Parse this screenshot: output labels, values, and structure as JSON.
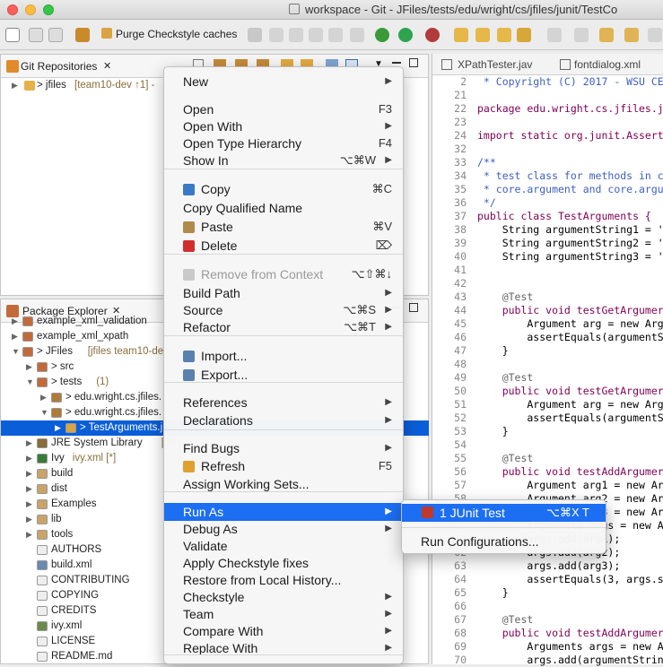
{
  "window": {
    "title": "workspace - Git - JFiles/tests/edu/wright/cs/jfiles/junit/TestCo"
  },
  "toolbar": {
    "purge_label": "Purge Checkstyle caches"
  },
  "git_view": {
    "tab_label": "Git Repositories",
    "tab_close": "✕",
    "repo_name": "> jfiles",
    "repo_meta": "[team10-dev ↑1] -"
  },
  "package_view": {
    "tab_label": "Package Explorer",
    "tab_close": "✕",
    "items": [
      {
        "label": "example_xml_validation",
        "meta": ""
      },
      {
        "label": "example_xml_xpath",
        "meta": ""
      },
      {
        "label": "> JFiles",
        "meta": "[jfiles team10-dev"
      },
      {
        "label": "> src",
        "meta": ""
      },
      {
        "label": "> tests",
        "meta": "(1)"
      },
      {
        "label": "> edu.wright.cs.jfiles.",
        "meta": ""
      },
      {
        "label": "> edu.wright.cs.jfiles.",
        "meta": ""
      },
      {
        "label": "> TestArguments.j",
        "meta": ""
      },
      {
        "label": "JRE System Library",
        "meta": "[Jav"
      },
      {
        "label": "Ivy",
        "meta": "ivy.xml [*]"
      },
      {
        "label": "build",
        "meta": ""
      },
      {
        "label": "dist",
        "meta": ""
      },
      {
        "label": "Examples",
        "meta": ""
      },
      {
        "label": "lib",
        "meta": ""
      },
      {
        "label": "tools",
        "meta": ""
      },
      {
        "label": "AUTHORS",
        "meta": ""
      },
      {
        "label": "build.xml",
        "meta": ""
      },
      {
        "label": "CONTRIBUTING",
        "meta": ""
      },
      {
        "label": "COPYING",
        "meta": ""
      },
      {
        "label": "CREDITS",
        "meta": ""
      },
      {
        "label": "ivy.xml",
        "meta": ""
      },
      {
        "label": "LICENSE",
        "meta": ""
      },
      {
        "label": "README.md",
        "meta": ""
      }
    ]
  },
  "editor": {
    "tabs": [
      "XPathTester.jav",
      "fontdialog.xml"
    ],
    "lines": [
      {
        "n": "2",
        "text": " * Copyright (C) 2017 - WSU CE"
      },
      {
        "n": "21",
        "text": ""
      },
      {
        "n": "22",
        "text": "package edu.wright.cs.jfiles.j"
      },
      {
        "n": "23",
        "text": ""
      },
      {
        "n": "24",
        "text": "import static org.junit.Assert"
      },
      {
        "n": "32",
        "text": ""
      },
      {
        "n": "33",
        "text": "/**"
      },
      {
        "n": "34",
        "text": " * test class for methods in c"
      },
      {
        "n": "35",
        "text": " * core.argument and core.argu"
      },
      {
        "n": "36",
        "text": " */"
      },
      {
        "n": "37",
        "text": "public class TestArguments {"
      },
      {
        "n": "38",
        "text": "    String argumentString1 = '"
      },
      {
        "n": "39",
        "text": "    String argumentString2 = '"
      },
      {
        "n": "40",
        "text": "    String argumentString3 = '"
      },
      {
        "n": "41",
        "text": ""
      },
      {
        "n": "42",
        "text": ""
      },
      {
        "n": "43",
        "text": "    @Test"
      },
      {
        "n": "44",
        "text": "    public void testGetArgumer"
      },
      {
        "n": "45",
        "text": "        Argument arg = new Arg"
      },
      {
        "n": "46",
        "text": "        assertEquals(argumentS"
      },
      {
        "n": "47",
        "text": "    }"
      },
      {
        "n": "48",
        "text": ""
      },
      {
        "n": "49",
        "text": "    @Test"
      },
      {
        "n": "50",
        "text": "    public void testGetArgumer"
      },
      {
        "n": "51",
        "text": "        Argument arg = new Arg"
      },
      {
        "n": "52",
        "text": "        assertEquals(argumentS"
      },
      {
        "n": "53",
        "text": "    }"
      },
      {
        "n": "54",
        "text": ""
      },
      {
        "n": "55",
        "text": "    @Test"
      },
      {
        "n": "56",
        "text": "    public void testAddArgumer"
      },
      {
        "n": "57",
        "text": "        Argument arg1 = new Ar"
      },
      {
        "n": "58",
        "text": "        Argument arg2 = new Ar"
      },
      {
        "n": "59",
        "text": "        Argument arg3 = new Ar"
      },
      {
        "n": "60",
        "text": "        Arguments args = new A"
      },
      {
        "n": "61",
        "text": "        args.add(arg1);"
      },
      {
        "n": "62",
        "text": "        args.add(arg2);"
      },
      {
        "n": "63",
        "text": "        args.add(arg3);"
      },
      {
        "n": "64",
        "text": "        assertEquals(3, args.s"
      },
      {
        "n": "65",
        "text": "    }"
      },
      {
        "n": "66",
        "text": ""
      },
      {
        "n": "67",
        "text": "    @Test"
      },
      {
        "n": "68",
        "text": "    public void testAddArgumer"
      },
      {
        "n": "69",
        "text": "        Arguments args = new A"
      },
      {
        "n": "70",
        "text": "        args.add(argumentStrin"
      }
    ]
  },
  "context_menu": {
    "items": [
      {
        "label": "New",
        "shortcut": "",
        "submenu": true,
        "disabled": false
      },
      {
        "label": "Open",
        "shortcut": "F3",
        "submenu": false,
        "disabled": false
      },
      {
        "label": "Open With",
        "shortcut": "",
        "submenu": true,
        "disabled": false
      },
      {
        "label": "Open Type Hierarchy",
        "shortcut": "F4",
        "submenu": false,
        "disabled": false
      },
      {
        "label": "Show In",
        "shortcut": "⌥⌘W",
        "submenu": true,
        "disabled": false
      },
      {
        "label": "Copy",
        "shortcut": "⌘C",
        "submenu": false,
        "disabled": false
      },
      {
        "label": "Copy Qualified Name",
        "shortcut": "",
        "submenu": false,
        "disabled": false
      },
      {
        "label": "Paste",
        "shortcut": "⌘V",
        "submenu": false,
        "disabled": false
      },
      {
        "label": "Delete",
        "shortcut": "⌦",
        "submenu": false,
        "disabled": false
      },
      {
        "label": "Remove from Context",
        "shortcut": "⌥⇧⌘↓",
        "submenu": false,
        "disabled": true
      },
      {
        "label": "Build Path",
        "shortcut": "",
        "submenu": true,
        "disabled": false
      },
      {
        "label": "Source",
        "shortcut": "⌥⌘S",
        "submenu": true,
        "disabled": false
      },
      {
        "label": "Refactor",
        "shortcut": "⌥⌘T",
        "submenu": true,
        "disabled": false
      },
      {
        "label": "Import...",
        "shortcut": "",
        "submenu": false,
        "disabled": false
      },
      {
        "label": "Export...",
        "shortcut": "",
        "submenu": false,
        "disabled": false
      },
      {
        "label": "References",
        "shortcut": "",
        "submenu": true,
        "disabled": false
      },
      {
        "label": "Declarations",
        "shortcut": "",
        "submenu": true,
        "disabled": false
      },
      {
        "label": "Find Bugs",
        "shortcut": "",
        "submenu": true,
        "disabled": false
      },
      {
        "label": "Refresh",
        "shortcut": "F5",
        "submenu": false,
        "disabled": false
      },
      {
        "label": "Assign Working Sets...",
        "shortcut": "",
        "submenu": false,
        "disabled": false
      },
      {
        "label": "Run As",
        "shortcut": "",
        "submenu": true,
        "disabled": false
      },
      {
        "label": "Debug As",
        "shortcut": "",
        "submenu": true,
        "disabled": false
      },
      {
        "label": "Validate",
        "shortcut": "",
        "submenu": false,
        "disabled": false
      },
      {
        "label": "Apply Checkstyle fixes",
        "shortcut": "",
        "submenu": false,
        "disabled": false
      },
      {
        "label": "Restore from Local History...",
        "shortcut": "",
        "submenu": false,
        "disabled": false
      },
      {
        "label": "Checkstyle",
        "shortcut": "",
        "submenu": true,
        "disabled": false
      },
      {
        "label": "Team",
        "shortcut": "",
        "submenu": true,
        "disabled": false
      },
      {
        "label": "Compare With",
        "shortcut": "",
        "submenu": true,
        "disabled": false
      },
      {
        "label": "Replace With",
        "shortcut": "",
        "submenu": true,
        "disabled": false
      }
    ]
  },
  "run_as_submenu": {
    "junit_label": "1 JUnit Test",
    "junit_shortcut": "⌥⌘X T",
    "run_config_label": "Run Configurations..."
  },
  "colors": {
    "accent": "#1c6ef2",
    "selection": "#0a5fd8"
  }
}
